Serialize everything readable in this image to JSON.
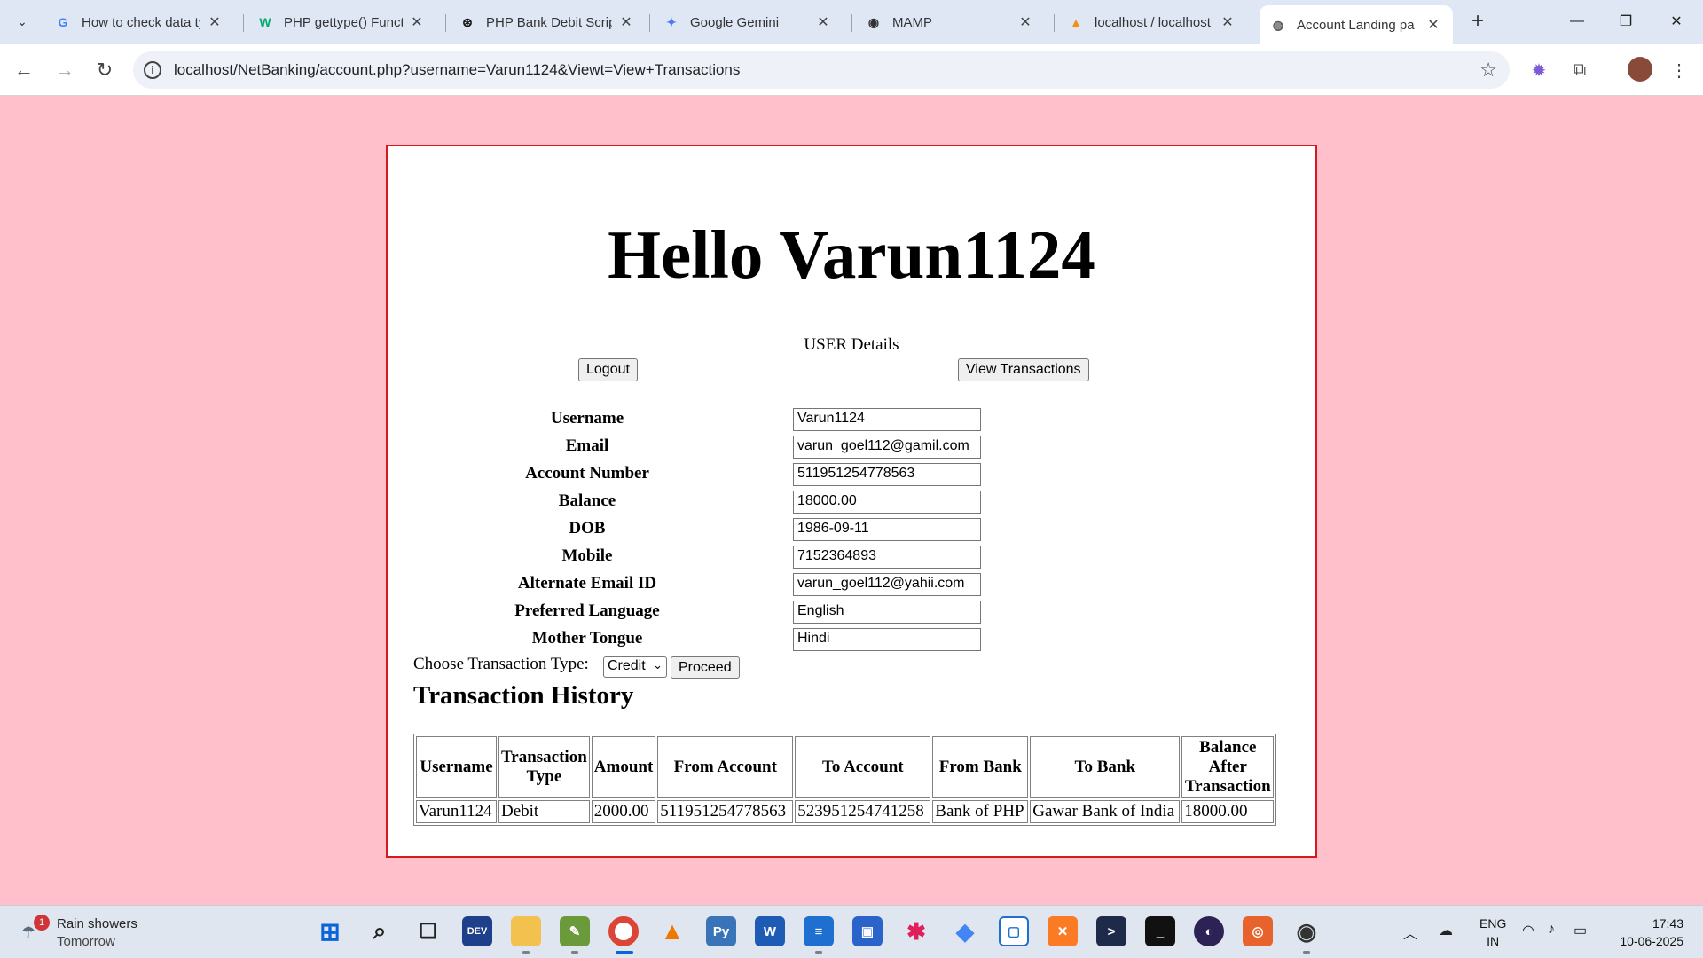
{
  "browser": {
    "tabs": [
      {
        "title": "How to check data ty",
        "icon": "google-icon"
      },
      {
        "title": "PHP gettype() Functi",
        "icon": "w3-icon"
      },
      {
        "title": "PHP Bank Debit Scrip",
        "icon": "chatgpt-icon"
      },
      {
        "title": "Google Gemini",
        "icon": "gemini-icon"
      },
      {
        "title": "MAMP",
        "icon": "github-icon"
      },
      {
        "title": "localhost / localhost",
        "icon": "phpmyadmin-icon"
      },
      {
        "title": "Account Landing pa",
        "icon": "globe-icon"
      }
    ],
    "url": "localhost/NetBanking/account.php?username=Varun1124&Viewt=View+Transactions"
  },
  "page": {
    "greeting": "Hello Varun1124",
    "section_title": "USER Details",
    "logout_label": "Logout",
    "view_transactions_label": "View Transactions",
    "details": [
      {
        "label": "Username",
        "value": "Varun1124"
      },
      {
        "label": "Email",
        "value": "varun_goel112@gamil.com"
      },
      {
        "label": "Account Number",
        "value": "511951254778563"
      },
      {
        "label": "Balance",
        "value": "18000.00"
      },
      {
        "label": "DOB",
        "value": "1986-09-11"
      },
      {
        "label": "Mobile",
        "value": "7152364893"
      },
      {
        "label": "Alternate Email ID",
        "value": "varun_goel112@yahii.com"
      },
      {
        "label": "Preferred Language",
        "value": "English"
      },
      {
        "label": "Mother Tongue",
        "value": "Hindi"
      }
    ],
    "transaction_type_label": "Choose Transaction Type:",
    "transaction_type_selected": "Credit",
    "proceed_label": "Proceed",
    "history_title": "Transaction History",
    "table": {
      "headers": [
        "Username",
        "Transaction Type",
        "Amount",
        "From Account",
        "To Account",
        "From Bank",
        "To Bank",
        "Balance After Transaction"
      ],
      "rows": [
        [
          "Varun1124",
          "Debit",
          "2000.00",
          "511951254778563",
          "523951254741258",
          "Bank of PHP",
          "Gawar Bank of India",
          "18000.00"
        ]
      ]
    }
  },
  "taskbar": {
    "weather_title": "Rain showers",
    "weather_sub": "Tomorrow",
    "weather_badge": "1",
    "lang_line1": "ENG",
    "lang_line2": "IN",
    "time": "17:43",
    "date": "10-06-2025"
  },
  "colors": {
    "page_bg": "#ffc0cb",
    "card_border": "#d6181f"
  }
}
